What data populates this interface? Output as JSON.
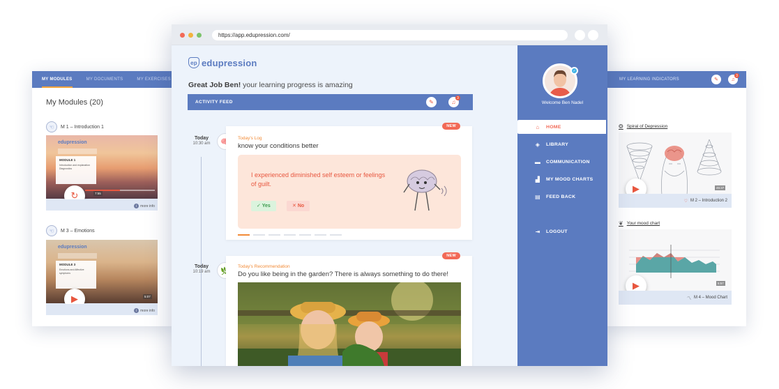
{
  "left_card": {
    "tabs": [
      "MY MODULES",
      "MY DOCUMENTS",
      "MY EXERCISES"
    ],
    "title": "My Modules (20)",
    "modules": [
      {
        "label": "M 1 – Introduction 1",
        "thumb_logo": "edupression",
        "box_title": "MODULE 1",
        "box_sub": "Introduction and explanation Diagnostics",
        "duration": "7:55",
        "progress": 0.5,
        "more_info": "more info",
        "action_icon": "replay-icon"
      },
      {
        "label": "M 3 – Emotions",
        "thumb_logo": "edupression",
        "box_title": "MODULE 3",
        "box_sub": "Emotions and Affective symptoms",
        "duration": "5:07",
        "more_info": "more info",
        "action_icon": "play-icon"
      }
    ]
  },
  "browser": {
    "url": "https://app.edupression.com/",
    "logo_text": "edupression",
    "greeting_bold": "Great Job Ben!",
    "greeting_rest": " your learning progress is amazing",
    "feed_label": "ACTIVITY FEED",
    "feed_badge": "3",
    "items": [
      {
        "day": "Today",
        "time": "10:30 am",
        "badge": "NEW",
        "tag": "Today's Log",
        "question": "know your conditions better",
        "prompt": "I experienced diminished self esteem or feelings of guilt.",
        "yes_label": "Yes",
        "no_label": "No"
      },
      {
        "day": "Today",
        "time": "10:19 am",
        "badge": "NEW",
        "tag": "Today's Recommendation",
        "question": "Do you like being in the garden? There is always something to do there!"
      }
    ]
  },
  "sidebar": {
    "welcome": "Welcome Ben Nadel",
    "nav": [
      {
        "label": "HOME",
        "icon": "home-icon",
        "active": true
      },
      {
        "label": "LIBRARY",
        "icon": "library-icon"
      },
      {
        "label": "COMMUNICATION",
        "icon": "chat-icon"
      },
      {
        "label": "MY MOOD CHARTS",
        "icon": "chart-icon"
      },
      {
        "label": "FEED BACK",
        "icon": "feedback-icon"
      },
      {
        "label": "LOGOUT",
        "icon": "logout-icon"
      }
    ]
  },
  "right_card": {
    "bar_label": "MY LEARNING INDICATORS",
    "badge": "3",
    "items": [
      {
        "label": "Spiral of Depression",
        "duration": "45:37",
        "footer": "M 2 – Introduction 2"
      },
      {
        "label": "Your mood chart",
        "duration": "5:57",
        "footer": "M 4 – Mood Chart"
      }
    ]
  },
  "colors": {
    "brand_blue": "#5b7bc0",
    "accent_red": "#f26a57",
    "accent_orange": "#f28b37",
    "prompt_bg": "#fde6da"
  }
}
